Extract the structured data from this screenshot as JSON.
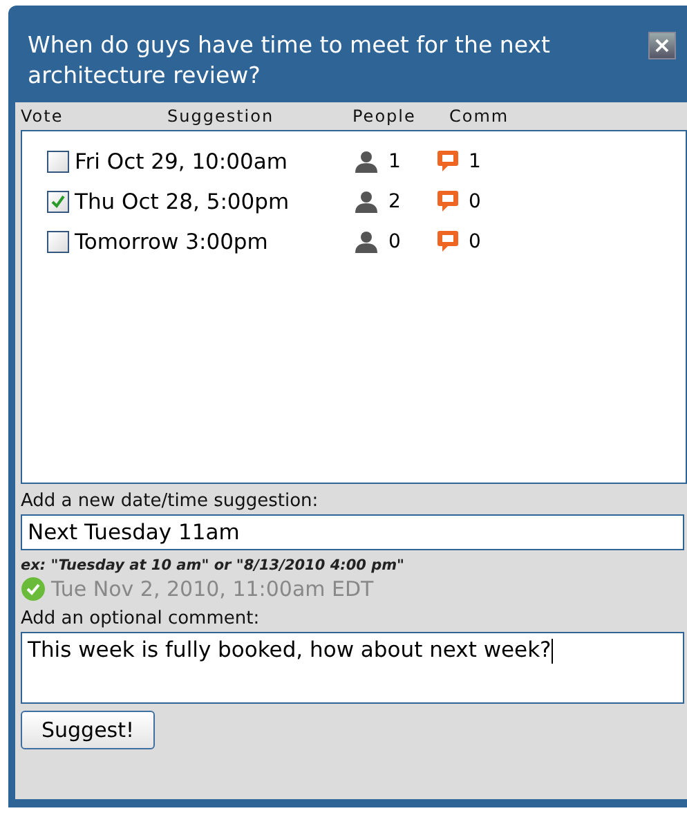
{
  "dialog": {
    "title": "When do guys have time to meet for the next architecture review?",
    "close": "×"
  },
  "columns": [
    "Vote",
    "Suggestion",
    "People",
    "Comm"
  ],
  "rows": [
    {
      "checked": false,
      "suggestion": "Fri Oct 29, 10:00am",
      "people": "1",
      "comments": "1"
    },
    {
      "checked": true,
      "suggestion": "Thu Oct 28, 5:00pm",
      "people": "2",
      "comments": "0"
    },
    {
      "checked": false,
      "suggestion": "Tomorrow 3:00pm",
      "people": "0",
      "comments": "0"
    }
  ],
  "new_suggestion": {
    "label": "Add a new date/time suggestion:",
    "value": "Next Tuesday 11am",
    "example": "ex: \"Tuesday at 10 am\" or \"8/13/2010 4:00 pm\"",
    "parsed": "Tue Nov 2, 2010, 11:00am EDT"
  },
  "comment": {
    "label": "Add an optional comment:",
    "value": "This week is fully booked, how about next week?"
  },
  "buttons": [
    "Suggest!"
  ]
}
